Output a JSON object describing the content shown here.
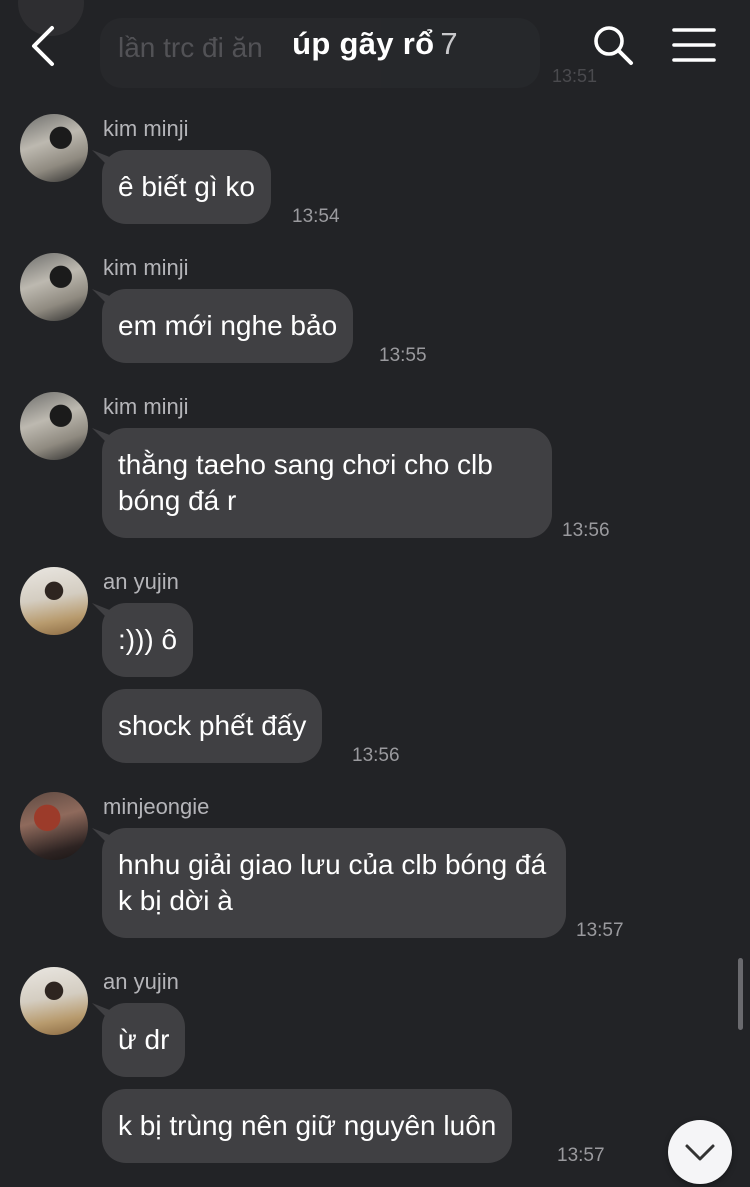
{
  "header": {
    "title": "úp gãy rổ",
    "member_count": "7",
    "preview_text": "lần trc đi ăn",
    "preview_time": "13:51"
  },
  "messages": [
    {
      "sender": "kim minji",
      "text": "ê biết gì ko",
      "time": "13:54"
    },
    {
      "sender": "kim minji",
      "text": "em mới nghe bảo",
      "time": "13:55"
    },
    {
      "sender": "kim minji",
      "text": "thằng taeho sang chơi cho clb bóng đá r",
      "time": "13:56"
    },
    {
      "sender": "an yujin",
      "text": ":))) ô"
    },
    {
      "text": "shock phết đấy",
      "time": "13:56"
    },
    {
      "sender": "minjeongie",
      "text": "hnhu giải giao lưu của clb bóng đá k bị dời à",
      "time": "13:57"
    },
    {
      "sender": "an yujin",
      "text": "ừ dr"
    },
    {
      "text": "k bị trùng nên giữ nguyên luôn",
      "time": "13:57"
    }
  ],
  "icons": {
    "back": "chevron-left",
    "search": "magnifier",
    "menu": "hamburger",
    "scroll_down": "chevron-down"
  },
  "colors": {
    "background": "#222326",
    "bubble": "#404043",
    "text": "#ffffff",
    "muted": "#9a9a9e"
  }
}
